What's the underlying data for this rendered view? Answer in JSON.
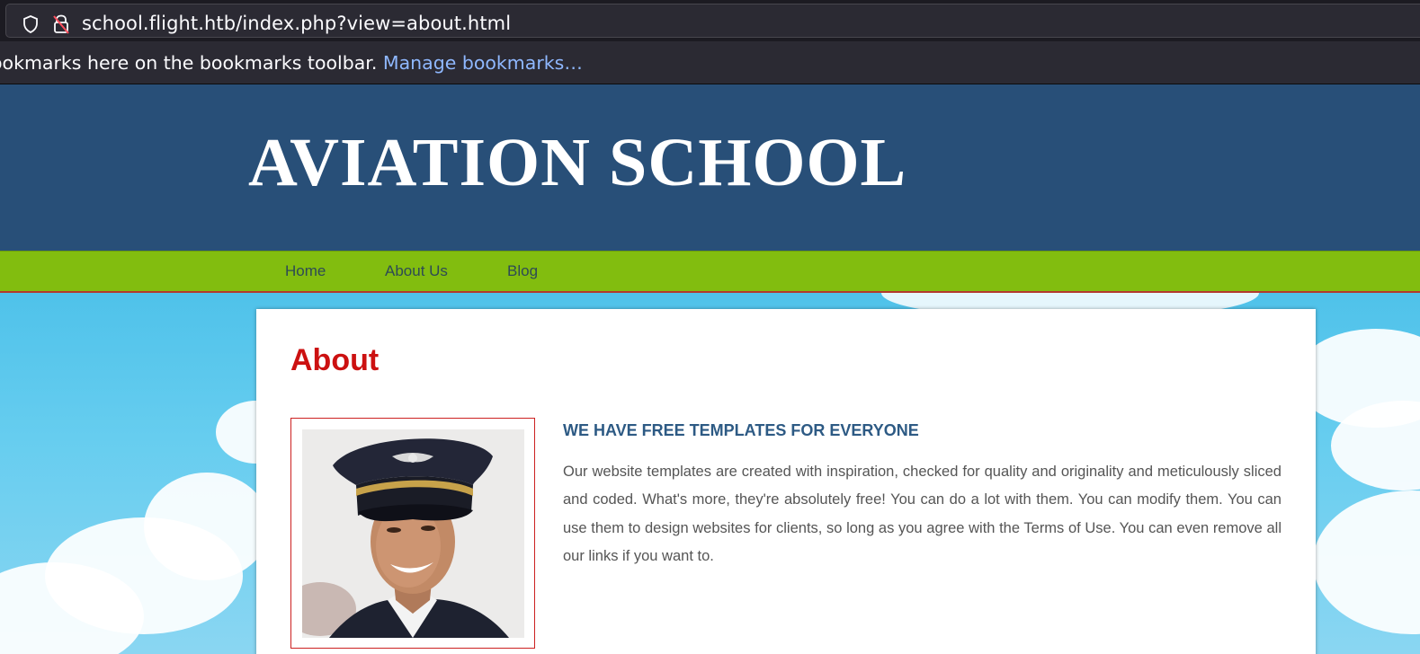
{
  "browser": {
    "url": "school.flight.htb/index.php?view=about.html",
    "bookmarks_text": "ookmarks here on the bookmarks toolbar. ",
    "bookmarks_link": "Manage bookmarks…"
  },
  "header": {
    "title": "AVIATION SCHOOL"
  },
  "nav": {
    "items": [
      {
        "label": "Home"
      },
      {
        "label": "About Us"
      },
      {
        "label": "Blog"
      }
    ]
  },
  "main": {
    "heading": "About",
    "section_title": "WE HAVE FREE TEMPLATES FOR EVERYONE",
    "body": "Our website templates are created with inspiration, checked for quality and originality and meticulously sliced and coded. What's more, they're absolutely free! You can do a lot with them. You can modify them. You can use them to design websites for clients, so long as you agree with the Terms of Use. You can even remove all our links if you want to."
  },
  "colors": {
    "header_bg": "#284f78",
    "nav_bg": "#82bd0f",
    "heading_red": "#cc1111",
    "section_blue": "#2d5a84"
  },
  "icons": {
    "shield": "shield-icon",
    "lock": "lock-insecure-icon",
    "photo": "pilot-photo"
  }
}
